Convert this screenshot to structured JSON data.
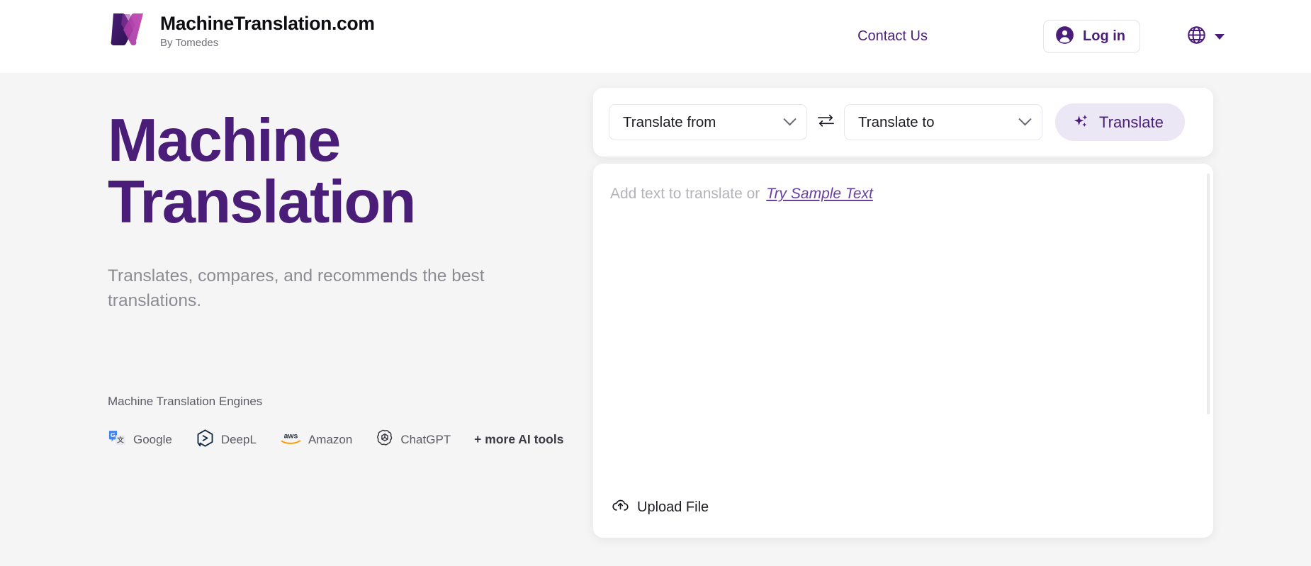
{
  "header": {
    "brand_name": "MachineTranslation.com",
    "brand_sub": "By Tomedes",
    "logo_icon": "machinetranslation-m-logo",
    "contact_label": "Contact Us",
    "login_label": "Log in",
    "login_icon": "user-circle-icon",
    "language_icon": "globe-icon",
    "language_caret_icon": "caret-down-icon"
  },
  "hero": {
    "title_line_1": "Machine",
    "title_line_2": "Translation",
    "subtitle": "Translates, compares, and recommends the best translations.",
    "engines_label": "Machine Translation Engines",
    "engines": [
      {
        "name": "Google",
        "icon": "google-translate-icon"
      },
      {
        "name": "DeepL",
        "icon": "deepl-icon"
      },
      {
        "name": "Amazon",
        "icon": "aws-icon"
      },
      {
        "name": "ChatGPT",
        "icon": "openai-icon"
      }
    ],
    "more_tools_label": "+ more AI tools"
  },
  "translator": {
    "source_language": "Translate from",
    "target_language": "Translate to",
    "swap_icon": "swap-arrows-icon",
    "translate_button_label": "Translate",
    "translate_button_icon": "sparkles-icon",
    "editor_placeholder": "Add text to translate or",
    "sample_link_label": "Try Sample Text",
    "upload_label": "Upload File",
    "upload_icon": "cloud-upload-icon"
  },
  "colors": {
    "brand_purple": "#4a1d78",
    "accent_magenta": "#c545b0",
    "button_bg": "#ece7f5",
    "page_bg": "#f5f5f5",
    "card_bg": "#ffffff",
    "muted_text": "#8c8c93"
  }
}
